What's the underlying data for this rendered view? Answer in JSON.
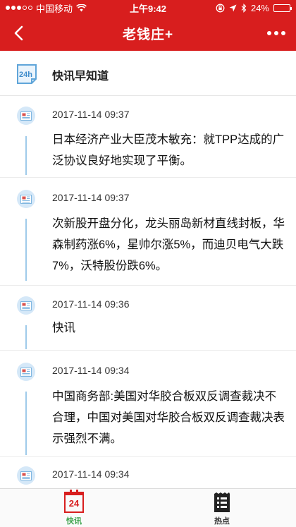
{
  "status_bar": {
    "carrier": "中国移动",
    "time": "上午9:42",
    "battery_percent": "24%",
    "battery_level": 0.24
  },
  "nav": {
    "title": "老钱庄+"
  },
  "section": {
    "icon_text": "24h",
    "title": "快讯早知道"
  },
  "news": [
    {
      "time": "2017-11-14 09:37",
      "text": "日本经济产业大臣茂木敏充：就TPP达成的广泛协议良好地实现了平衡。"
    },
    {
      "time": "2017-11-14 09:37",
      "text": "次新股开盘分化，龙头丽岛新材直线封板，华森制药涨6%，星帅尔涨5%，而迪贝电气大跌7%，沃特股份跌6%。"
    },
    {
      "time": "2017-11-14 09:36",
      "text": "快讯"
    },
    {
      "time": "2017-11-14 09:34",
      "text": "中国商务部:美国对华胶合板双反调查裁决不合理，中国对美国对华胶合板双反调查裁决表示强烈不满。"
    },
    {
      "time": "2017-11-14 09:34",
      "text": ""
    }
  ],
  "tabs": [
    {
      "icon_text": "24",
      "label": "快讯",
      "active": true
    },
    {
      "label": "热点",
      "active": false
    }
  ],
  "colors": {
    "brand_red": "#d81e1e",
    "timeline_blue": "#9fcbea",
    "active_tab_green": "#3aa14a"
  }
}
